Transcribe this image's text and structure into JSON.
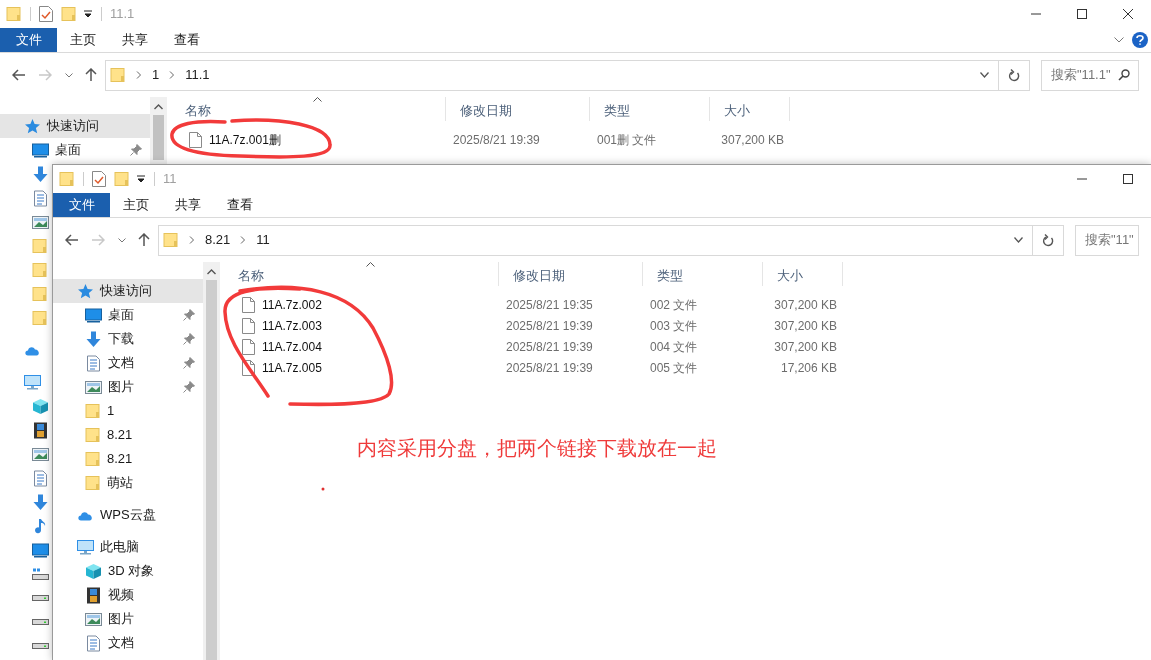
{
  "windows": [
    {
      "title": "11.1",
      "controls": [
        {
          "kind": "minimize"
        },
        {
          "kind": "maximize"
        },
        {
          "kind": "close"
        }
      ],
      "ribbon_help": true,
      "ribbon_tabs": [
        {
          "label": "文件",
          "selected": true
        },
        {
          "label": "主页",
          "selected": false
        },
        {
          "label": "共享",
          "selected": false
        },
        {
          "label": "查看",
          "selected": false
        }
      ],
      "path": [
        "1",
        "11.1"
      ],
      "search": {
        "placeholder": "搜索\"11.1\"",
        "icon": true
      },
      "sidebar": [
        {
          "kind": "quick-access",
          "label": "快速访问",
          "selected": true,
          "children": [
            {
              "kind": "desktop",
              "label": "桌面",
              "pinned": true,
              "selected": false
            },
            {
              "kind": "downloads",
              "selected": false
            },
            {
              "kind": "documents",
              "selected": false
            },
            {
              "kind": "pictures",
              "selected": false
            },
            {
              "kind": "folder",
              "selected": false
            },
            {
              "kind": "folder",
              "selected": false
            },
            {
              "kind": "folder",
              "selected": false
            },
            {
              "kind": "folder",
              "selected": false
            }
          ]
        },
        {
          "kind": "cloud",
          "selected": false
        },
        {
          "kind": "this-pc",
          "selected": false,
          "children": [
            {
              "kind": "objects",
              "selected": false
            },
            {
              "kind": "videos",
              "selected": false
            },
            {
              "kind": "pictures",
              "selected": false
            },
            {
              "kind": "documents",
              "selected": false
            },
            {
              "kind": "downloads",
              "selected": false
            },
            {
              "kind": "music",
              "selected": false
            },
            {
              "kind": "desktop",
              "selected": false
            },
            {
              "kind": "system-drive",
              "selected": false
            },
            {
              "kind": "drive",
              "selected": false
            },
            {
              "kind": "drive",
              "selected": false
            },
            {
              "kind": "drive",
              "selected": false
            }
          ]
        }
      ],
      "columns": [
        "名称",
        "修改日期",
        "类型",
        "大小"
      ],
      "files": [
        {
          "name": "11A.7z.001删",
          "date": "2025/8/21 19:39",
          "type": "001删 文件",
          "size": "307,200 KB"
        }
      ]
    },
    {
      "title": "11",
      "controls": [
        {
          "kind": "minimize"
        },
        {
          "kind": "maximize"
        }
      ],
      "ribbon_help": false,
      "ribbon_tabs": [
        {
          "label": "文件",
          "selected": true
        },
        {
          "label": "主页",
          "selected": false
        },
        {
          "label": "共享",
          "selected": false
        },
        {
          "label": "查看",
          "selected": false
        }
      ],
      "path": [
        "8.21",
        "11"
      ],
      "search": {
        "placeholder": "搜索\"11\"",
        "icon": false
      },
      "sidebar": [
        {
          "kind": "quick-access",
          "label": "快速访问",
          "selected": true,
          "children": [
            {
              "kind": "desktop",
              "label": "桌面",
              "pinned": true,
              "selected": false
            },
            {
              "kind": "downloads",
              "label": "下载",
              "pinned": true,
              "selected": false
            },
            {
              "kind": "documents",
              "label": "文档",
              "pinned": true,
              "selected": false
            },
            {
              "kind": "pictures",
              "label": "图片",
              "pinned": true,
              "selected": false
            },
            {
              "kind": "folder",
              "label": "1",
              "selected": false
            },
            {
              "kind": "folder",
              "label": "8.21",
              "selected": false
            },
            {
              "kind": "folder",
              "label": "8.21",
              "selected": false
            },
            {
              "kind": "folder",
              "label": "萌站",
              "selected": false
            }
          ]
        },
        {
          "kind": "cloud",
          "label": "WPS云盘",
          "selected": false
        },
        {
          "kind": "this-pc",
          "label": "此电脑",
          "selected": false,
          "children": [
            {
              "kind": "objects",
              "label": "3D 对象",
              "selected": false
            },
            {
              "kind": "videos",
              "label": "视频",
              "selected": false
            },
            {
              "kind": "pictures",
              "label": "图片",
              "selected": false
            },
            {
              "kind": "documents",
              "label": "文档",
              "selected": false
            }
          ]
        }
      ],
      "columns": [
        "名称",
        "修改日期",
        "类型",
        "大小"
      ],
      "files": [
        {
          "name": "11A.7z.002",
          "date": "2025/8/21 19:35",
          "type": "002 文件",
          "size": "307,200 KB"
        },
        {
          "name": "11A.7z.003",
          "date": "2025/8/21 19:39",
          "type": "003 文件",
          "size": "307,200 KB"
        },
        {
          "name": "11A.7z.004",
          "date": "2025/8/21 19:39",
          "type": "004 文件",
          "size": "307,200 KB"
        },
        {
          "name": "11A.7z.005",
          "date": "2025/8/21 19:39",
          "type": "005 文件",
          "size": "17,206 KB"
        }
      ]
    }
  ],
  "annotation": {
    "text": "内容采用分盘，把两个链接下载放在一起"
  }
}
